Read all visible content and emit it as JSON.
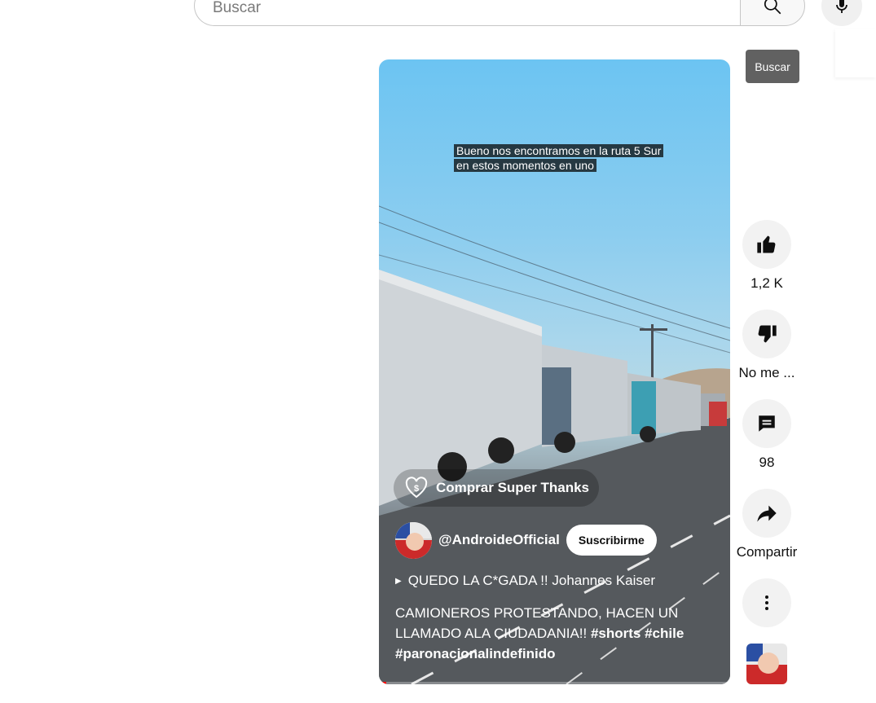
{
  "search": {
    "placeholder": "Buscar",
    "tooltip": "Buscar"
  },
  "icons": {
    "search": "search-icon",
    "mic": "mic-icon",
    "like": "thumbs-up-icon",
    "dislike": "thumbs-down-icon",
    "comments": "comment-icon",
    "share": "share-icon",
    "more": "more-vert-icon",
    "super_thanks": "super-thanks-icon"
  },
  "video": {
    "caption_line1": "Bueno nos encontramos en la ruta 5 Sur",
    "caption_line2": "en estos momentos en uno",
    "super_thanks": "Comprar Super Thanks",
    "channel_handle": "@AndroideOfficial",
    "subscribe_label": "Suscribirme",
    "sound_title": "QUEDO LA C*GADA !! Johannes Kaiser",
    "description_text": "CAMIONEROS PROTESTANDO, HACEN UN LLAMADO ALA CIUDADANIA!! ",
    "description_tags": "#shorts #chile #paronacionalindefinido",
    "progress": 0.02
  },
  "actions": {
    "like_count": "1,2 K",
    "dislike_label": "No me ...",
    "comments_count": "98",
    "share_label": "Compartir"
  },
  "colors": {
    "accent": "#ff0000",
    "tooltip_bg": "#616161",
    "action_bg": "#f2f2f2"
  }
}
